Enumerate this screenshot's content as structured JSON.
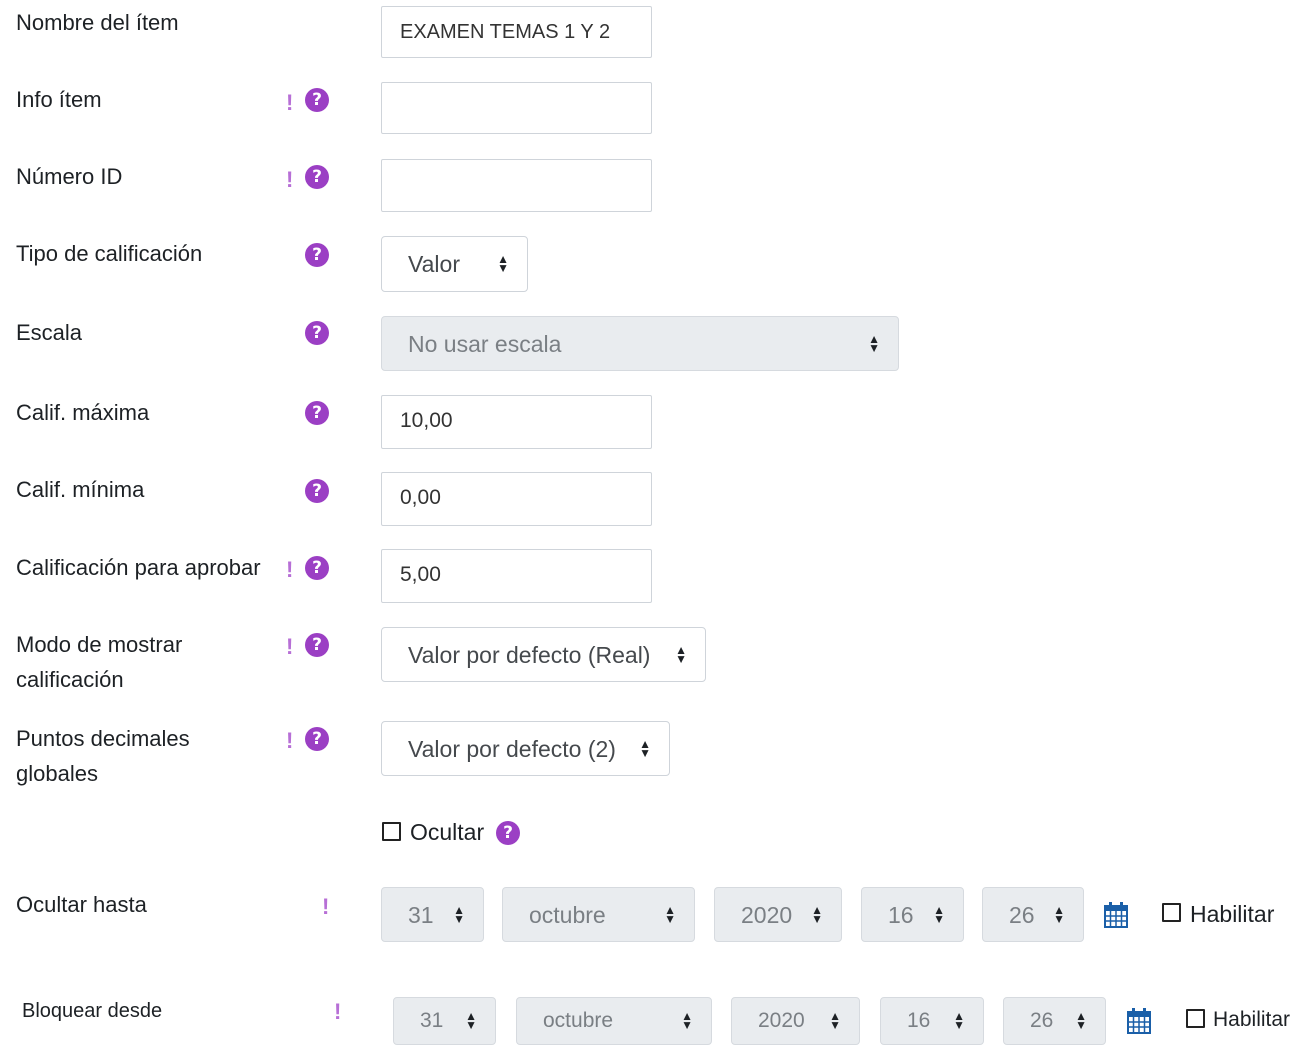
{
  "fields": {
    "item_name": {
      "label": "Nombre del ítem",
      "value": "EXAMEN TEMAS 1 Y 2"
    },
    "item_info": {
      "label": "Info ítem",
      "value": ""
    },
    "id_number": {
      "label": "Número ID",
      "value": ""
    },
    "grade_type": {
      "label": "Tipo de calificación",
      "value": "Valor"
    },
    "scale": {
      "label": "Escala",
      "value": "No usar escala"
    },
    "max_grade": {
      "label": "Calif. máxima",
      "value": "10,00"
    },
    "min_grade": {
      "label": "Calif. mínima",
      "value": "0,00"
    },
    "pass_grade": {
      "label": "Calificación para aprobar",
      "value": "5,00"
    },
    "display_type": {
      "label_line1": "Modo de mostrar",
      "label_line2": "calificación",
      "value": "Valor por defecto (Real)"
    },
    "decimals": {
      "label_line1": "Puntos decimales",
      "label_line2": "globales",
      "value": "Valor por defecto (2)"
    },
    "hide": {
      "label": "Ocultar",
      "checked": false
    },
    "hidden_until": {
      "label": "Ocultar hasta",
      "day": "31",
      "month": "octubre",
      "year": "2020",
      "hour": "16",
      "minute": "26",
      "enable_label": "Habilitar",
      "enabled": false
    },
    "lock_after": {
      "label": "Bloquear desde",
      "day": "31",
      "month": "octubre",
      "year": "2020",
      "hour": "16",
      "minute": "26",
      "enable_label": "Habilitar",
      "enabled": false
    }
  },
  "glyphs": {
    "required": "!",
    "help": "?",
    "caret_up": "▲",
    "caret_down": "▼"
  },
  "colors": {
    "accent": "#9b3fc4",
    "required": "#b76fd6",
    "calendar": "#1a5fa8"
  }
}
